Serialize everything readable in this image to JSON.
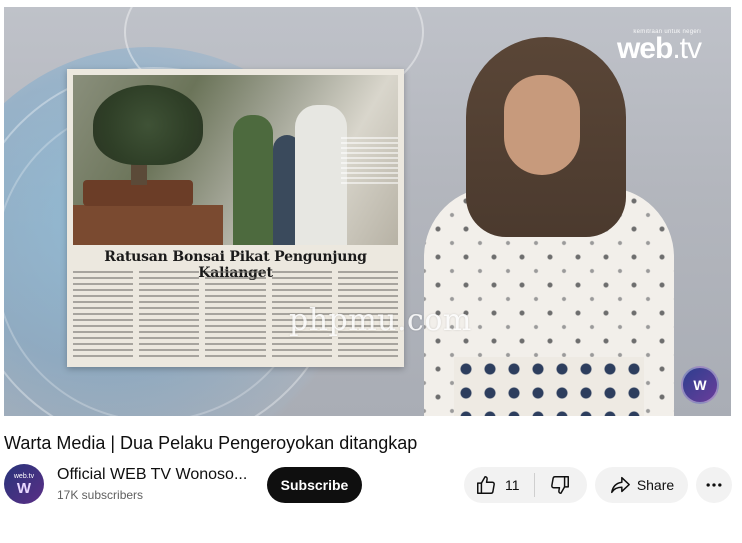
{
  "video": {
    "logo_tagline": "kemitraan untuk negeri",
    "logo_name": "web",
    "logo_suffix": ".tv",
    "newspaper_headline": "Ratusan Bonsai Pikat Pengunjung Kalianget",
    "watermark": "phpmu.com",
    "corner_badge": "W"
  },
  "title": "Warta Media | Dua Pelaku Pengeroyokan ditangkap",
  "channel": {
    "avatar_text": "web.tv",
    "avatar_mark": "W",
    "name": "Official WEB TV Wonoso...",
    "subscribers": "17K subscribers",
    "subscribe_label": "Subscribe"
  },
  "actions": {
    "like_count": "11",
    "share_label": "Share",
    "like_icon": "thumbs-up-icon",
    "dislike_icon": "thumbs-down-icon",
    "share_icon": "share-arrow-icon",
    "more_icon": "more-horizontal-icon"
  }
}
